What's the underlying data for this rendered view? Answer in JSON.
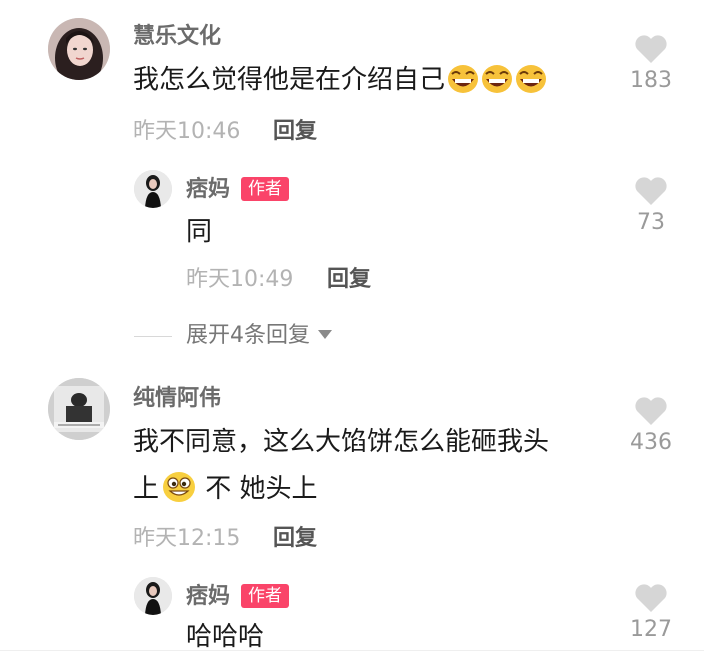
{
  "comments": [
    {
      "username": "慧乐文化",
      "text": "我怎么觉得他是在介绍自己",
      "emoji": "laughing-emoji",
      "emoji_count": 3,
      "time": "昨天10:46",
      "reply_label": "回复",
      "likes": "183",
      "replies": [
        {
          "username": "痞妈",
          "badge": "作者",
          "text": "同",
          "time": "昨天10:49",
          "reply_label": "回复",
          "likes": "73"
        }
      ],
      "expand_label": "展开4条回复"
    },
    {
      "username": "纯情阿伟",
      "text_line1": "我不同意，这么大馅饼怎么能砸我头",
      "text_line2_a": "上",
      "emoji": "silly-grin-emoji",
      "text_line2_b": " 不 她头上",
      "time": "昨天12:15",
      "reply_label": "回复",
      "likes": "436",
      "replies": [
        {
          "username": "痞妈",
          "badge": "作者",
          "text": "哈哈哈",
          "likes": "127"
        }
      ]
    }
  ],
  "colors": {
    "badge": "#fa4469",
    "username": "#6b6b6b",
    "text": "#1a1a1a",
    "meta": "#b3b3b3",
    "like_icon": "#d6d6d6"
  }
}
